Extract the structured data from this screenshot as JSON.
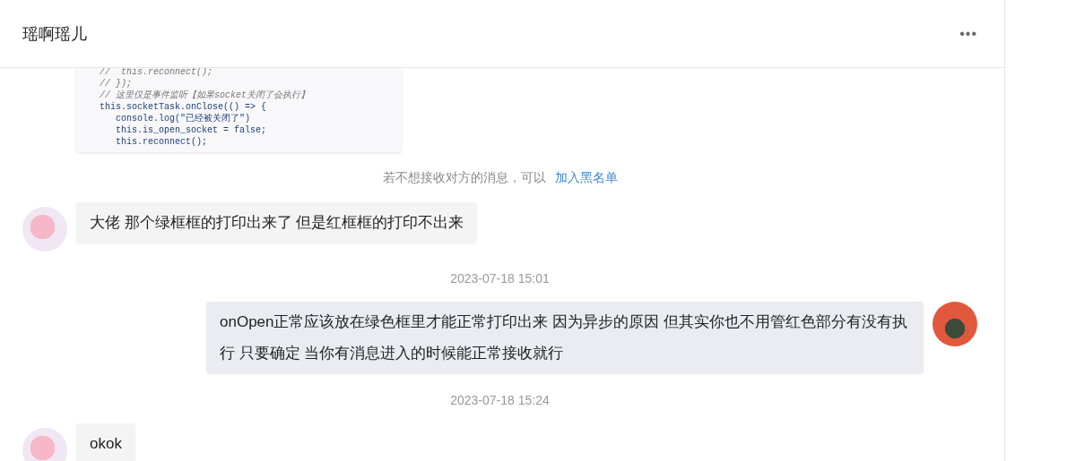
{
  "header": {
    "title": "瑶啊瑶儿",
    "more_icon": "•••"
  },
  "messages": [
    {
      "kind": "image",
      "code_lines": [
        {
          "kind": "comment",
          "text": "//  this.reconnect();"
        },
        {
          "kind": "comment",
          "text": "// });"
        },
        {
          "kind": "comment",
          "text": "// 这里仅是事件监听【如果socket关闭了会执行】"
        },
        {
          "kind": "code",
          "text": "this.socketTask.onClose(() => {",
          "children": [
            {
              "kind": "code",
              "text": "console.log(\"已经被关闭了\")"
            },
            {
              "kind": "code",
              "text": "this.is_open_socket = false;"
            },
            {
              "kind": "code",
              "text": "this.reconnect();"
            }
          ]
        }
      ]
    },
    {
      "kind": "notice",
      "text": "若不想接收对方的消息，可以",
      "link": "加入黑名单"
    },
    {
      "kind": "incoming",
      "text": "大佬 那个绿框框的打印出来了 但是红框框的打印不出来"
    },
    {
      "kind": "time",
      "text": "2023-07-18 15:01"
    },
    {
      "kind": "outgoing",
      "text": "onOpen正常应该放在绿色框里才能正常打印出来 因为异步的原因 但其实你也不用管红色部分有没有执行 只要确定 当你有消息进入的时候能正常接收就行"
    },
    {
      "kind": "time",
      "text": "2023-07-18 15:24"
    },
    {
      "kind": "incoming",
      "text": "okok"
    }
  ]
}
